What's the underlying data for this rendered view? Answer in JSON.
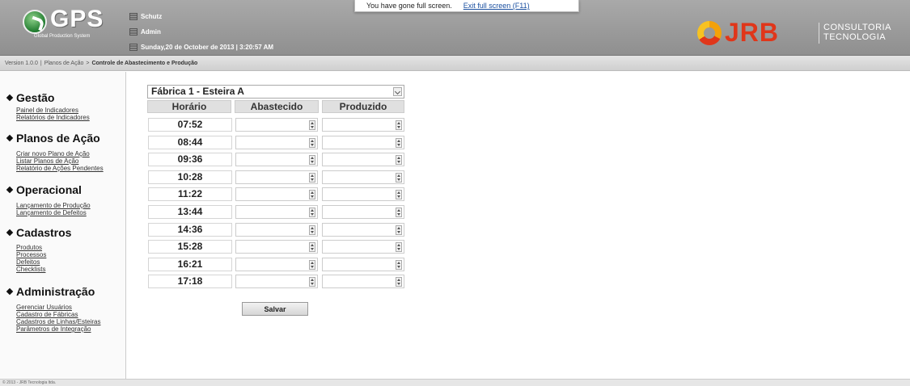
{
  "header": {
    "logo_text": "GPS",
    "logo_subtitle": "Global Production System",
    "info": [
      {
        "icon": "company-icon",
        "text": "Schutz"
      },
      {
        "icon": "user-icon",
        "text": "Admin"
      },
      {
        "icon": "calendar-icon",
        "text": "Sunday,20 de October de 2013 | 3:20:57 AM"
      }
    ],
    "fullscreen_message": "You have gone full screen.",
    "fullscreen_exit_link": "Exit full screen (F11)",
    "brand": {
      "name": "JRB",
      "line1": "CONSULTORIA",
      "line2": "TECNOLOGIA"
    }
  },
  "breadcrumb": {
    "version": "Version 1.0.0",
    "separator": "|",
    "section": "Planos de Ação",
    "arrow": ">",
    "current": "Controle de Abastecimento e Produção"
  },
  "sidebar": {
    "sections": [
      {
        "title": "Gestão",
        "links": [
          "Painel de Indicadores",
          "Relatórios de Indicadores"
        ]
      },
      {
        "title": "Planos de Ação",
        "links": [
          "Criar novo Plano de Ação",
          "Listar Planos de Ação",
          "Relatório de Ações Pendentes"
        ]
      },
      {
        "title": "Operacional",
        "links": [
          "Lançamento de Produção",
          "Lançamento de Defeitos"
        ]
      },
      {
        "title": "Cadastros",
        "links": [
          "Produtos",
          "Processos",
          "Defeitos",
          "Checklists"
        ]
      },
      {
        "title": "Administração",
        "links": [
          "Gerenciar Usuários",
          "Cadastro de Fábricas",
          "Cadastros de Linhas/Esteiras",
          "Parâmetros de Integração"
        ]
      }
    ]
  },
  "form": {
    "line_select": "Fábrica 1 - Esteira A",
    "columns": [
      "Horário",
      "Abastecido",
      "Produzido"
    ],
    "times": [
      "07:52",
      "08:44",
      "09:36",
      "10:28",
      "11:22",
      "13:44",
      "14:36",
      "15:28",
      "16:21",
      "17:18"
    ],
    "save_label": "Salvar"
  },
  "footer": {
    "text": "© 2013 - JRB Tecnologia ltda."
  }
}
